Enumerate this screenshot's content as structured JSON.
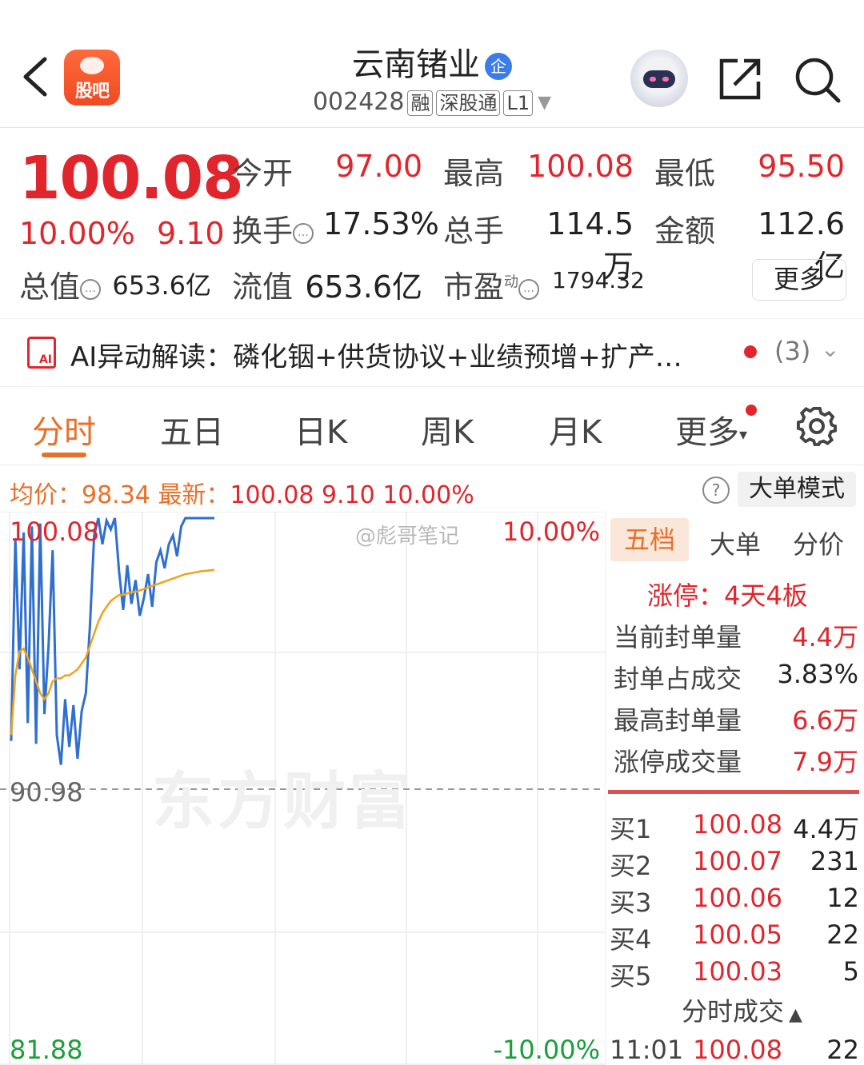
{
  "header": {
    "title": "云南锗业",
    "badge": "企",
    "code": "002428",
    "tags": [
      "融",
      "深股通",
      "L1"
    ],
    "guba_label": "股吧"
  },
  "quote": {
    "price": "100.08",
    "change_pct": "10.00%",
    "change": "9.10",
    "open_label": "今开",
    "open": "97.00",
    "high_label": "最高",
    "high": "100.08",
    "low_label": "最低",
    "low": "95.50",
    "turnover_label": "换手",
    "turnover": "17.53%",
    "volume_label": "总手",
    "volume": "114.5万",
    "amount_label": "金额",
    "amount": "112.6亿",
    "mktcap_label": "总值",
    "mktcap": "653.6亿",
    "float_label": "流值",
    "float": "653.6亿",
    "pe_label": "市盈",
    "pe_sup": "动",
    "pe": "1794.32",
    "more": "更多"
  },
  "ai": {
    "text": "AI异动解读：磷化铟+供货协议+业绩预增+扩产…",
    "count": "(3)"
  },
  "tabs": [
    "分时",
    "五日",
    "日K",
    "周K",
    "月K",
    "更多"
  ],
  "strip": {
    "avg_label": "均价：",
    "avg": "98.34",
    "latest_label": "最新：",
    "latest": "100.08",
    "chg": "9.10",
    "pct": "10.00%",
    "mode_button": "大单模式"
  },
  "chart": {
    "top_price": "100.08",
    "mid_price": "90.98",
    "bottom_price": "81.88",
    "top_pct": "10.00%",
    "bottom_pct": "-10.00%",
    "watermark": "东方财富",
    "weibo": "@彪哥笔记"
  },
  "chart_data": {
    "type": "line",
    "ylim": [
      81.88,
      100.08
    ],
    "reference": 90.98,
    "series": [
      {
        "values": [
          92.6,
          99.4,
          95.0,
          99.6,
          93.2,
          99.8,
          92.5,
          99.9,
          93.5,
          95.8,
          99.0,
          92.8,
          91.8,
          94.0,
          92.4,
          93.8,
          92.0,
          93.6,
          94.2,
          96.5,
          99.5,
          100.08,
          99.2,
          100.0,
          99.7,
          100.08,
          98.3,
          97.0,
          98.5,
          97.2,
          98.0,
          96.8,
          97.4,
          98.2,
          97.1,
          98.6,
          99.0,
          98.4,
          99.2,
          99.5,
          98.8,
          99.8,
          100.08,
          100.08,
          100.08,
          100.08,
          100.08,
          100.08,
          100.08,
          100.08
        ]
      },
      {
        "values": [
          92.8,
          94.8,
          95.6,
          95.7,
          95.4,
          95.0,
          94.6,
          94.2,
          94.0,
          94.2,
          94.6,
          94.7,
          94.7,
          94.8,
          94.8,
          94.9,
          95.0,
          95.2,
          95.4,
          95.8,
          96.2,
          96.6,
          96.9,
          97.1,
          97.3,
          97.4,
          97.5,
          97.5,
          97.55,
          97.6,
          97.6,
          97.65,
          97.7,
          97.75,
          97.8,
          97.85,
          97.9,
          97.95,
          98.0,
          98.05,
          98.1,
          98.15,
          98.2,
          98.22,
          98.25,
          98.27,
          98.3,
          98.31,
          98.33,
          98.34
        ]
      }
    ],
    "colors": [
      "#2f6fd0",
      "#f0a21a"
    ]
  },
  "panel": {
    "tabs": [
      "五档",
      "大单",
      "分价"
    ],
    "limit": "涨停：4天4板",
    "stats": [
      {
        "label": "当前封单量",
        "value": "4.4万",
        "color": "red"
      },
      {
        "label": "封单占成交",
        "value": "3.83%",
        "color": "dark"
      },
      {
        "label": "最高封单量",
        "value": "6.6万",
        "color": "red"
      },
      {
        "label": "涨停成交量",
        "value": "7.9万",
        "color": "red"
      }
    ],
    "bids": [
      {
        "name": "买1",
        "price": "100.08",
        "qty": "4.4万"
      },
      {
        "name": "买2",
        "price": "100.07",
        "qty": "231"
      },
      {
        "name": "买3",
        "price": "100.06",
        "qty": "12"
      },
      {
        "name": "买4",
        "price": "100.05",
        "qty": "22"
      },
      {
        "name": "买5",
        "price": "100.03",
        "qty": "5"
      }
    ],
    "tick_title": "分时成交",
    "tick": {
      "time": "11:01",
      "price": "100.08",
      "qty": "22"
    }
  }
}
